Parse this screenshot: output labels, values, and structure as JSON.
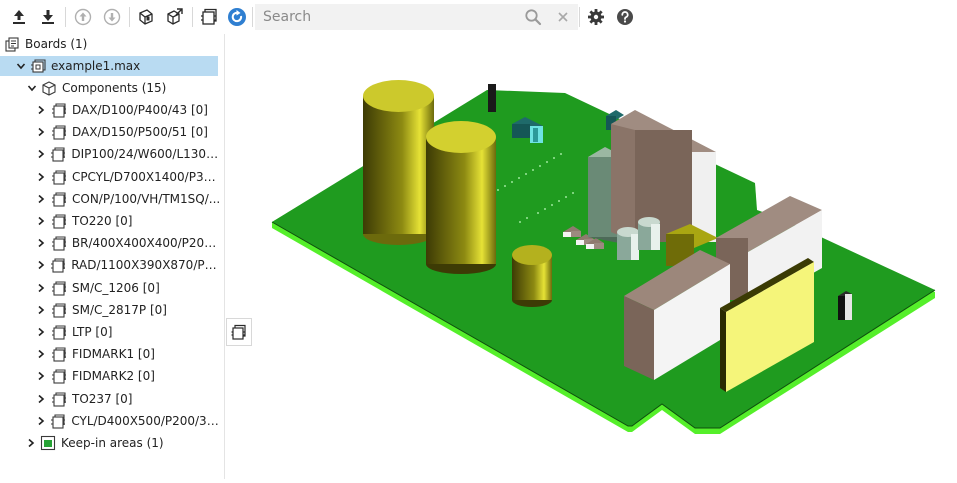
{
  "toolbar": {
    "buttons": [
      {
        "name": "upload-icon"
      },
      {
        "name": "download-icon"
      },
      {
        "name": "move-up-icon"
      },
      {
        "name": "move-down-icon"
      },
      {
        "name": "paste-component-icon"
      },
      {
        "name": "edit-component-icon"
      },
      {
        "name": "component-library-icon"
      },
      {
        "name": "refresh-icon"
      }
    ],
    "search_placeholder": "Search",
    "search_value": "",
    "right_icons": [
      "search-icon",
      "clear-icon",
      "settings-icon",
      "help-icon"
    ]
  },
  "tree": {
    "boards_label": "Boards (1)",
    "board_label": "example1.max",
    "components_label": "Components (15)",
    "components": [
      "DAX/D100/P400/43 [0]",
      "DAX/D150/P500/51 [0]",
      "DIP100/24/W600/L1300 ...",
      "CPCYL/D700X1400/P30...",
      "CON/P/100/VH/TM1SQ/...",
      "TO220 [0]",
      "BR/400X400X400/P200...",
      "RAD/1100X390X870/P89...",
      "SM/C_1206 [0]",
      "SM/C_2817P [0]",
      "LTP [0]",
      "FIDMARK1 [0]",
      "FIDMARK2 [0]",
      "TO237 [0]",
      "CYL/D400X500/P200/31 ..."
    ],
    "keepin_label": "Keep-in areas (1)"
  },
  "colors": {
    "selection": "#b9dbf2",
    "board_green": "#1f9b1f",
    "board_edge": "#55ef2a",
    "cap_yellow": "#b7b21b",
    "connector_brown": "#8f7a6f",
    "label_yellow": "#f5f57a",
    "keepin_green": "#27a336"
  }
}
